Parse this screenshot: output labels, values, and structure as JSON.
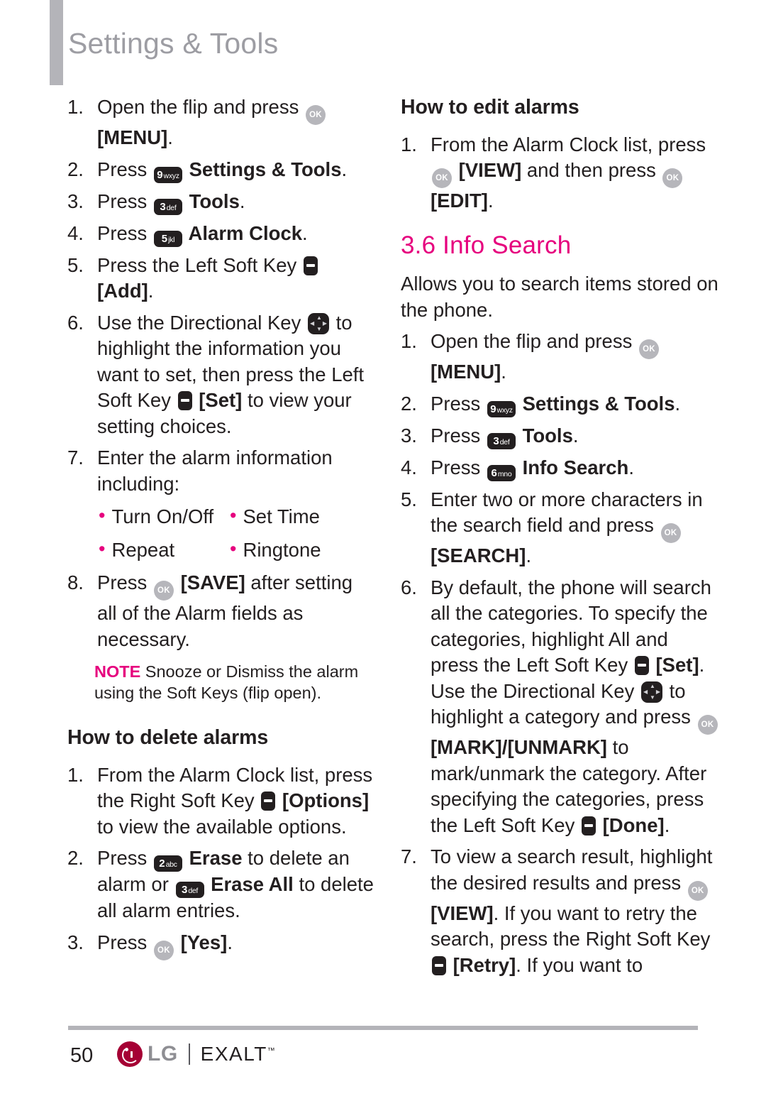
{
  "header": {
    "title": "Settings & Tools"
  },
  "colors": {
    "accent_magenta": "#e6007e",
    "header_gray": "#9d9da3",
    "bar_gray": "#b4b4b9",
    "lg_crimson": "#a50034"
  },
  "left_column": {
    "alarm_add_steps": [
      {
        "num": "1.",
        "parts": [
          {
            "t": "text",
            "v": "Open the flip and press "
          },
          {
            "t": "key",
            "kind": "ok",
            "name": "ok-key-icon"
          },
          {
            "t": "bold",
            "v": " [MENU]"
          },
          {
            "t": "text",
            "v": "."
          }
        ]
      },
      {
        "num": "2.",
        "parts": [
          {
            "t": "text",
            "v": "Press "
          },
          {
            "t": "key",
            "kind": "num",
            "digit": "9",
            "letters": "wxyz",
            "name": "key-9-wxyz-icon"
          },
          {
            "t": "bold",
            "v": " Settings & Tools"
          },
          {
            "t": "text",
            "v": "."
          }
        ]
      },
      {
        "num": "3.",
        "parts": [
          {
            "t": "text",
            "v": "Press "
          },
          {
            "t": "key",
            "kind": "num",
            "digit": "3",
            "letters": "def",
            "name": "key-3-def-icon"
          },
          {
            "t": "bold",
            "v": " Tools"
          },
          {
            "t": "text",
            "v": "."
          }
        ]
      },
      {
        "num": "4.",
        "parts": [
          {
            "t": "text",
            "v": "Press "
          },
          {
            "t": "key",
            "kind": "num",
            "digit": "5",
            "letters": "jkl",
            "name": "key-5-jkl-icon"
          },
          {
            "t": "bold",
            "v": " Alarm Clock"
          },
          {
            "t": "text",
            "v": "."
          }
        ]
      },
      {
        "num": "5.",
        "parts": [
          {
            "t": "text",
            "v": "Press the Left Soft Key "
          },
          {
            "t": "key",
            "kind": "soft",
            "name": "soft-key-icon"
          },
          {
            "t": "bold",
            "v": " [Add]"
          },
          {
            "t": "text",
            "v": "."
          }
        ]
      },
      {
        "num": "6.",
        "parts": [
          {
            "t": "text",
            "v": "Use the Directional Key "
          },
          {
            "t": "key",
            "kind": "dir",
            "name": "directional-key-icon"
          },
          {
            "t": "text",
            "v": " to highlight the information you want to set, then press the Left Soft Key "
          },
          {
            "t": "key",
            "kind": "soft",
            "name": "soft-key-icon"
          },
          {
            "t": "bold",
            "v": " [Set]"
          },
          {
            "t": "text",
            "v": " to view your setting choices."
          }
        ]
      },
      {
        "num": "7.",
        "parts": [
          {
            "t": "text",
            "v": "Enter the alarm information including:"
          }
        ]
      }
    ],
    "alarm_fields": [
      [
        "Turn On/Off",
        "Set Time"
      ],
      [
        "Repeat",
        "Ringtone"
      ]
    ],
    "alarm_step_8": {
      "num": "8.",
      "parts": [
        {
          "t": "text",
          "v": "Press "
        },
        {
          "t": "key",
          "kind": "ok",
          "name": "ok-key-icon"
        },
        {
          "t": "bold",
          "v": " [SAVE]"
        },
        {
          "t": "text",
          "v": " after setting all of the Alarm fields as necessary."
        }
      ]
    },
    "note": {
      "label": "NOTE",
      "text": " Snooze or Dismiss the alarm using the Soft Keys (flip open)."
    },
    "delete_heading": "How to delete alarms",
    "delete_steps": [
      {
        "num": "1.",
        "parts": [
          {
            "t": "text",
            "v": "From the Alarm Clock list, press the Right Soft Key "
          },
          {
            "t": "key",
            "kind": "soft",
            "name": "soft-key-icon"
          },
          {
            "t": "bold",
            "v": " [Options]"
          },
          {
            "t": "text",
            "v": " to view the available options."
          }
        ]
      },
      {
        "num": "2.",
        "parts": [
          {
            "t": "text",
            "v": "Press "
          },
          {
            "t": "key",
            "kind": "num",
            "digit": "2",
            "letters": "abc",
            "name": "key-2-abc-icon"
          },
          {
            "t": "bold",
            "v": " Erase"
          },
          {
            "t": "text",
            "v": " to delete an alarm or "
          },
          {
            "t": "key",
            "kind": "num",
            "digit": "3",
            "letters": "def",
            "name": "key-3-def-icon"
          },
          {
            "t": "bold",
            "v": " Erase All"
          },
          {
            "t": "text",
            "v": " to delete all alarm entries."
          }
        ]
      },
      {
        "num": "3.",
        "parts": [
          {
            "t": "text",
            "v": "Press "
          },
          {
            "t": "key",
            "kind": "ok",
            "name": "ok-key-icon"
          },
          {
            "t": "bold",
            "v": " [Yes]"
          },
          {
            "t": "text",
            "v": "."
          }
        ]
      }
    ]
  },
  "right_column": {
    "edit_heading": "How to edit alarms",
    "edit_steps": [
      {
        "num": "1.",
        "parts": [
          {
            "t": "text",
            "v": "From the Alarm Clock list, press "
          },
          {
            "t": "key",
            "kind": "ok",
            "name": "ok-key-icon"
          },
          {
            "t": "bold",
            "v": " [VIEW]"
          },
          {
            "t": "text",
            "v": " and then press "
          },
          {
            "t": "key",
            "kind": "ok",
            "name": "ok-key-icon"
          },
          {
            "t": "bold",
            "v": " [EDIT]"
          },
          {
            "t": "text",
            "v": "."
          }
        ]
      }
    ],
    "section_heading": "3.6 Info Search",
    "intro": "Allows you to search items stored on the phone.",
    "search_steps": [
      {
        "num": "1.",
        "parts": [
          {
            "t": "text",
            "v": "Open the flip and press "
          },
          {
            "t": "key",
            "kind": "ok",
            "name": "ok-key-icon"
          },
          {
            "t": "bold",
            "v": " [MENU]"
          },
          {
            "t": "text",
            "v": "."
          }
        ]
      },
      {
        "num": "2.",
        "parts": [
          {
            "t": "text",
            "v": "Press "
          },
          {
            "t": "key",
            "kind": "num",
            "digit": "9",
            "letters": "wxyz",
            "name": "key-9-wxyz-icon"
          },
          {
            "t": "bold",
            "v": " Settings & Tools"
          },
          {
            "t": "text",
            "v": "."
          }
        ]
      },
      {
        "num": "3.",
        "parts": [
          {
            "t": "text",
            "v": "Press "
          },
          {
            "t": "key",
            "kind": "num",
            "digit": "3",
            "letters": "def",
            "name": "key-3-def-icon"
          },
          {
            "t": "bold",
            "v": " Tools"
          },
          {
            "t": "text",
            "v": "."
          }
        ]
      },
      {
        "num": "4.",
        "parts": [
          {
            "t": "text",
            "v": "Press "
          },
          {
            "t": "key",
            "kind": "num",
            "digit": "6",
            "letters": "mno",
            "name": "key-6-mno-icon"
          },
          {
            "t": "bold",
            "v": " Info Search"
          },
          {
            "t": "text",
            "v": "."
          }
        ]
      },
      {
        "num": "5.",
        "parts": [
          {
            "t": "text",
            "v": "Enter two or more characters in the search field and press "
          },
          {
            "t": "key",
            "kind": "ok",
            "name": "ok-key-icon"
          },
          {
            "t": "bold",
            "v": " [SEARCH]"
          },
          {
            "t": "text",
            "v": "."
          }
        ]
      },
      {
        "num": "6.",
        "parts": [
          {
            "t": "text",
            "v": "By default, the phone will search all the categories. To specify the categories, highlight All and press the Left Soft Key "
          },
          {
            "t": "key",
            "kind": "soft",
            "name": "soft-key-icon"
          },
          {
            "t": "bold",
            "v": " [Set]"
          },
          {
            "t": "text",
            "v": ". Use the Directional Key "
          },
          {
            "t": "key",
            "kind": "dir",
            "name": "directional-key-icon"
          },
          {
            "t": "text",
            "v": " to highlight a category and press "
          },
          {
            "t": "key",
            "kind": "ok",
            "name": "ok-key-icon"
          },
          {
            "t": "bold",
            "v": " [MARK]/[UNMARK]"
          },
          {
            "t": "text",
            "v": " to mark/unmark the category. After specifying the categories, press the Left Soft Key "
          },
          {
            "t": "key",
            "kind": "soft",
            "name": "soft-key-icon"
          },
          {
            "t": "bold",
            "v": " [Done]"
          },
          {
            "t": "text",
            "v": "."
          }
        ]
      },
      {
        "num": "7.",
        "parts": [
          {
            "t": "text",
            "v": "To view a search result, highlight the desired results and press "
          },
          {
            "t": "key",
            "kind": "ok",
            "name": "ok-key-icon"
          },
          {
            "t": "bold",
            "v": " [VIEW]"
          },
          {
            "t": "text",
            "v": ". If you want to retry the search, press the Right Soft Key "
          },
          {
            "t": "key",
            "kind": "soft",
            "name": "soft-key-icon"
          },
          {
            "t": "bold",
            "v": " [Retry]"
          },
          {
            "t": "text",
            "v": ". If you want to"
          }
        ]
      }
    ]
  },
  "footer": {
    "page_number": "50",
    "brand": "LG",
    "model": "EXALT",
    "trademark": "™"
  }
}
